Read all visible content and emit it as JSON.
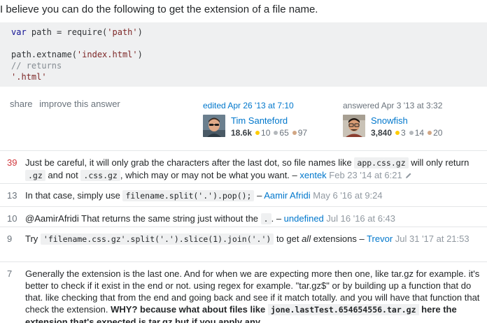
{
  "intro": "I believe you can do the following to get the extension of a file name.",
  "code": {
    "l1_kw": "var",
    "l1_a": " path = require(",
    "l1_str": "'path'",
    "l1_b": ")",
    "l3_a": "path.extname(",
    "l3_str": "'index.html'",
    "l3_b": ")",
    "l4": "// returns",
    "l5": "'.html'"
  },
  "post_menu": {
    "share": "share",
    "improve": "improve this answer"
  },
  "edited": {
    "action": "edited Apr 26 '13 at 7:10",
    "name": "Tim Santeford",
    "rep": "18.6k",
    "gold": "10",
    "silver": "65",
    "bronze": "97"
  },
  "answered": {
    "action": "answered Apr 3 '13 at 3:32",
    "name": "Snowfish",
    "rep": "3,840",
    "gold": "3",
    "silver": "14",
    "bronze": "20"
  },
  "comments": [
    {
      "score": "39",
      "t1": "Just be careful, it will only grab the characters after the last dot, so file names like ",
      "c1": "app.css.gz",
      "t2": " will only return ",
      "c2": ".gz",
      "t3": " and not ",
      "c3": ".css.gz",
      "t4": ", which may or may not be what you want. – ",
      "user": "xentek",
      "date": " Feb 23 '14 at 6:21"
    },
    {
      "score": "13",
      "t1": "In that case, simply use ",
      "c1": "filename.split('.').pop();",
      "t2": " – ",
      "user": "Aamir Afridi",
      "date": " May 6 '16 at 9:24"
    },
    {
      "score": "10",
      "t1": "@AamirAfridi That returns the same string just without the ",
      "c1": ".",
      "t2": ". – ",
      "user": "undefined",
      "date": " Jul 16 '16 at 6:43"
    },
    {
      "score": "9",
      "t1": "Try ",
      "c1": "'filename.css.gz'.split('.').slice(1).join('.')",
      "t2": " to get ",
      "em": "all",
      "t3": " extensions – ",
      "user": "Trevor",
      "date": " Jul 31 '17 at 21:53"
    },
    {
      "score": "7",
      "t1": "Generally the extension is the last one. And for when we are expecting more then one, like tar.gz for example. it's better to check if it exist in the end or not. using regex for example. \"tar.gz$\" or by building up a function that do that. like checking that from the end and going back and see if it match totally. and you will have that function that check the extension. ",
      "b1": "WHY? because what about files like ",
      "bc": "jone.lastTest.654654556.tar.gz",
      "b2": " here the extension that's expected is tar.gz but if you apply any"
    }
  ],
  "colors": {
    "link": "#0077cc",
    "hot_score": "#d1383d",
    "code_bg": "#eff0f1"
  },
  "icons": {
    "edit": "pencil-icon"
  }
}
